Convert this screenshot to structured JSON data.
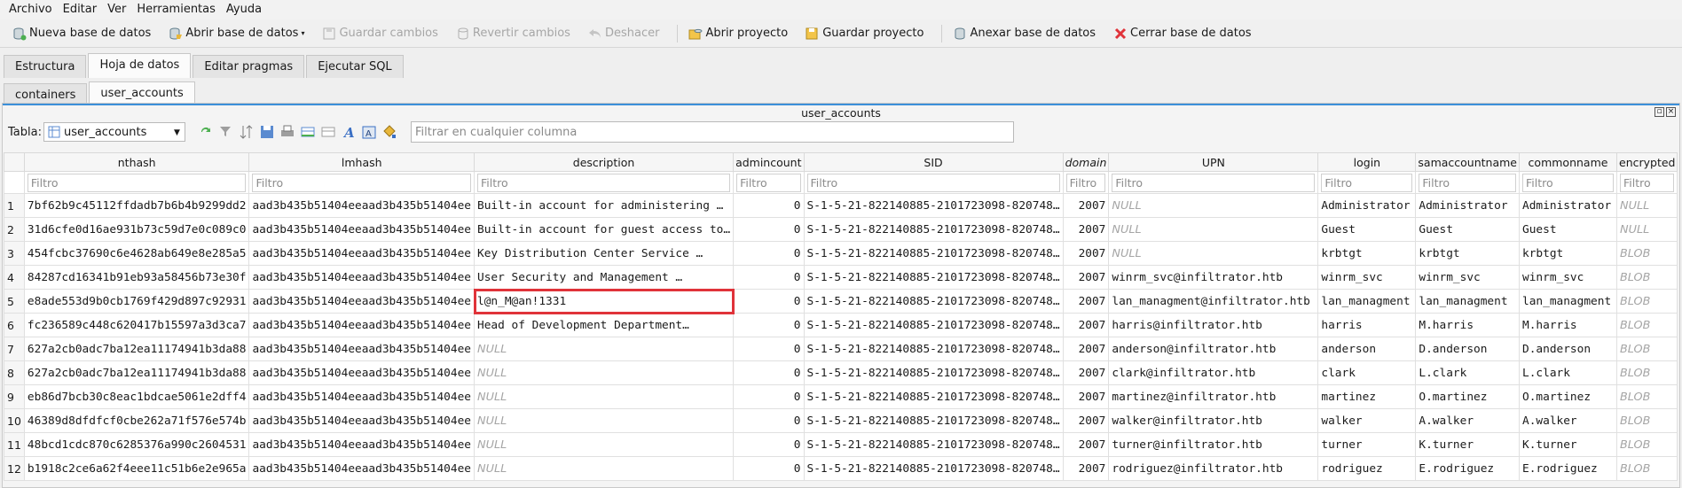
{
  "menu": [
    "Archivo",
    "Editar",
    "Ver",
    "Herramientas",
    "Ayuda"
  ],
  "toolbar": {
    "new_db": "Nueva base de datos",
    "open_db": "Abrir base de datos",
    "save_changes": "Guardar cambios",
    "revert_changes": "Revertir cambios",
    "undo": "Deshacer",
    "open_project": "Abrir proyecto",
    "save_project": "Guardar proyecto",
    "attach_db": "Anexar base de datos",
    "close_db": "Cerrar base de datos"
  },
  "main_tabs": [
    "Estructura",
    "Hoja de datos",
    "Editar pragmas",
    "Ejecutar SQL"
  ],
  "sub_tabs": [
    "containers",
    "user_accounts"
  ],
  "panel_title": "user_accounts",
  "table_bar": {
    "label": "Tabla:",
    "selected_table": "user_accounts",
    "filter_placeholder": "Filtrar en cualquier columna"
  },
  "filter_placeholder": "Filtro",
  "columns": [
    "nthash",
    "lmhash",
    "description",
    "admincount",
    "SID",
    "domain",
    "UPN",
    "login",
    "samaccountname",
    "commonname",
    "encrypted"
  ],
  "rows": [
    [
      "1",
      "7bf62b9c45112ffdadb7b6b4b9299dd2",
      "aad3b435b51404eeaad3b435b51404ee",
      "Built-in account for administering …",
      "0",
      "S-1-5-21-822140885-2101723098-820748…",
      "2007",
      "NULL",
      "Administrator",
      "Administrator",
      "Administrator",
      "NULL"
    ],
    [
      "2",
      "31d6cfe0d16ae931b73c59d7e0c089c0",
      "aad3b435b51404eeaad3b435b51404ee",
      "Built-in account for guest access to…",
      "0",
      "S-1-5-21-822140885-2101723098-820748…",
      "2007",
      "NULL",
      "Guest",
      "Guest",
      "Guest",
      "NULL"
    ],
    [
      "3",
      "454fcbc37690c6e4628ab649e8e285a5",
      "aad3b435b51404eeaad3b435b51404ee",
      "Key Distribution Center Service …",
      "0",
      "S-1-5-21-822140885-2101723098-820748…",
      "2007",
      "NULL",
      "krbtgt",
      "krbtgt",
      "krbtgt",
      "BLOB"
    ],
    [
      "4",
      "84287cd16341b91eb93a58456b73e30f",
      "aad3b435b51404eeaad3b435b51404ee",
      "User Security and Management …",
      "0",
      "S-1-5-21-822140885-2101723098-820748…",
      "2007",
      "winrm_svc@infiltrator.htb",
      "winrm_svc",
      "winrm_svc",
      "winrm_svc",
      "BLOB"
    ],
    [
      "5",
      "e8ade553d9b0cb1769f429d897c92931",
      "aad3b435b51404eeaad3b435b51404ee",
      "l@n_M@an!1331",
      "0",
      "S-1-5-21-822140885-2101723098-820748…",
      "2007",
      "lan_managment@infiltrator.htb",
      "lan_managment",
      "lan_managment",
      "lan_managment",
      "BLOB"
    ],
    [
      "6",
      "fc236589c448c620417b15597a3d3ca7",
      "aad3b435b51404eeaad3b435b51404ee",
      "Head of Development Department…",
      "0",
      "S-1-5-21-822140885-2101723098-820748…",
      "2007",
      "harris@infiltrator.htb",
      "harris",
      "M.harris",
      "M.harris",
      "BLOB"
    ],
    [
      "7",
      "627a2cb0adc7ba12ea11174941b3da88",
      "aad3b435b51404eeaad3b435b51404ee",
      "NULL",
      "0",
      "S-1-5-21-822140885-2101723098-820748…",
      "2007",
      "anderson@infiltrator.htb",
      "anderson",
      "D.anderson",
      "D.anderson",
      "BLOB"
    ],
    [
      "8",
      "627a2cb0adc7ba12ea11174941b3da88",
      "aad3b435b51404eeaad3b435b51404ee",
      "NULL",
      "0",
      "S-1-5-21-822140885-2101723098-820748…",
      "2007",
      "clark@infiltrator.htb",
      "clark",
      "L.clark",
      "L.clark",
      "BLOB"
    ],
    [
      "9",
      "eb86d7bcb30c8eac1bdcae5061e2dff4",
      "aad3b435b51404eeaad3b435b51404ee",
      "NULL",
      "0",
      "S-1-5-21-822140885-2101723098-820748…",
      "2007",
      "martinez@infiltrator.htb",
      "martinez",
      "O.martinez",
      "O.martinez",
      "BLOB"
    ],
    [
      "10",
      "46389d8dfdfcf0cbe262a71f576e574b",
      "aad3b435b51404eeaad3b435b51404ee",
      "NULL",
      "0",
      "S-1-5-21-822140885-2101723098-820748…",
      "2007",
      "walker@infiltrator.htb",
      "walker",
      "A.walker",
      "A.walker",
      "BLOB"
    ],
    [
      "11",
      "48bcd1cdc870c6285376a990c2604531",
      "aad3b435b51404eeaad3b435b51404ee",
      "NULL",
      "0",
      "S-1-5-21-822140885-2101723098-820748…",
      "2007",
      "turner@infiltrator.htb",
      "turner",
      "K.turner",
      "K.turner",
      "BLOB"
    ],
    [
      "12",
      "b1918c2ce6a62f4eee11c51b6e2e965a",
      "aad3b435b51404eeaad3b435b51404ee",
      "NULL",
      "0",
      "S-1-5-21-822140885-2101723098-820748…",
      "2007",
      "rodriguez@infiltrator.htb",
      "rodriguez",
      "E.rodriguez",
      "E.rodriguez",
      "BLOB"
    ]
  ],
  "highlight_color": "#e0333a",
  "accent_color": "#3b8fd9"
}
